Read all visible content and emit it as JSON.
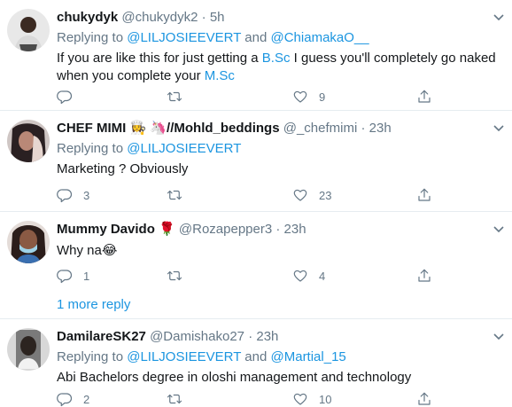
{
  "tweets": [
    {
      "name": "chukydyk",
      "handle": "@chukydyk2",
      "sep": " · ",
      "time": "5h",
      "replying_prefix": "Replying to ",
      "replying_to": [
        "@LILJOSIEEVERT",
        "@ChiamakaO__"
      ],
      "replying_and": " and ",
      "text_line1_a": "If you are like this for just getting a ",
      "text_line1_link": "B.Sc",
      "text_line1_b": " I guess you'll completely go naked",
      "text_line2_a": "when you complete your ",
      "text_line2_link": "M.Sc",
      "replies": "",
      "retweets": "",
      "likes": "9"
    },
    {
      "name": "CHEF MIMI",
      "name_suffix": "//Mohld_beddings",
      "handle": "@_chefmimi",
      "sep": " · ",
      "time": "23h",
      "replying_prefix": "Replying to ",
      "replying_to": [
        "@LILJOSIEEVERT"
      ],
      "text": "Marketing ? Obviously",
      "replies": "3",
      "retweets": "",
      "likes": "23"
    },
    {
      "name": "Mummy Davido",
      "handle": "@Rozapepper3",
      "sep": " · ",
      "time": "23h",
      "text": "Why na",
      "replies": "1",
      "retweets": "",
      "likes": "4"
    },
    {
      "name": "DamilareSK27",
      "handle": "@Damishako27",
      "sep": " · ",
      "time": "23h",
      "replying_prefix": "Replying to ",
      "replying_to": [
        "@LILJOSIEEVERT",
        "@Martial_15"
      ],
      "replying_and": " and ",
      "text": "Abi Bachelors degree in oloshi management and technology",
      "replies": "2",
      "retweets": "",
      "likes": "10"
    }
  ],
  "more_reply": "1 more reply",
  "icons": {
    "reply": "reply-icon",
    "retweet": "retweet-icon",
    "like": "heart-icon",
    "share": "share-icon",
    "menu": "chevron-down-icon"
  },
  "colors": {
    "link": "#1b95e0",
    "muted": "#657786",
    "divider": "#e6ecf0"
  }
}
